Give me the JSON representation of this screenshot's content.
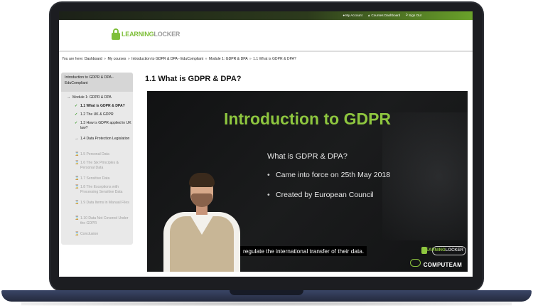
{
  "topnav": {
    "my_account": "My Account",
    "courses_dashboard": "Courses Dashboard",
    "sign_out": "Sign Out"
  },
  "logo": {
    "learning": "LEARNING",
    "locker": "LOCKER"
  },
  "breadcrumb": {
    "prefix": "You are here:",
    "items": [
      "Dashboard",
      "My courses",
      "Introduction to GDPR & DPA - EduCompliant",
      "Module 1: GDPR & DPA",
      "1.1 What is GDPR & DPA?"
    ],
    "separator": "»"
  },
  "sidebar": {
    "course_title": "Introduction to GDPR & DPA - EduCompliant",
    "items": [
      {
        "label": "Module 1: GDPR & DPA",
        "state": "current"
      },
      {
        "label": "1.1 What is GDPR & DPA?",
        "state": "done"
      },
      {
        "label": "1.2 The UK & GDPR",
        "state": "done"
      },
      {
        "label": "1.3 How is GDPR applied in UK law?",
        "state": "done"
      },
      {
        "label": "1.4 Data Protection Legislation",
        "state": "current"
      },
      {
        "label": "1.5 Personal Data",
        "state": "locked"
      },
      {
        "label": "1.6 The Six Principles & Personal Data",
        "state": "locked"
      },
      {
        "label": "1.7 Sensitive Data",
        "state": "locked"
      },
      {
        "label": "1.8 The Exceptions with Processing Sensitive Data",
        "state": "locked"
      },
      {
        "label": "1.9 Data Items in Manual Files",
        "state": "locked"
      },
      {
        "label": "1.10 Data Not Covered Under the GDPR",
        "state": "locked"
      },
      {
        "label": "Conclusion",
        "state": "locked"
      }
    ]
  },
  "main": {
    "lesson_title": "1.1 What is GDPR & DPA?"
  },
  "video": {
    "title": "Introduction to GDPR",
    "subtitle": "What is GDPR & DPA?",
    "bullets": [
      "Came into force on 25th May 2018",
      "Created by European Council"
    ],
    "caption": "regulate the international transfer of their data.",
    "brand_learning": "LEARNING",
    "brand_locker": "LOCKER",
    "brand_computeam": "COMPUTEAM"
  },
  "colors": {
    "accent_green": "#8ec63f",
    "done_check": "#3a9a2a",
    "topbar_dark": "#1c2118"
  },
  "icons": {
    "done": "check-icon",
    "current": "arrow-right-icon",
    "locked": "hourglass-icon"
  }
}
